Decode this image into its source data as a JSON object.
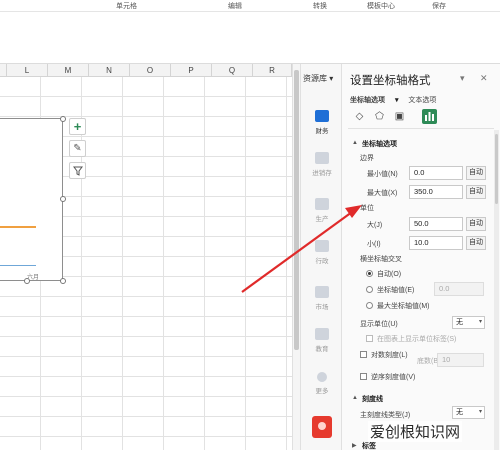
{
  "ribbon": {
    "groups": [
      "单元格",
      "编辑",
      "转换",
      "模板中心",
      "保存"
    ]
  },
  "sheet": {
    "columns": [
      "L",
      "M",
      "N",
      "O",
      "P",
      "Q",
      "R"
    ],
    "chart_axis_label": "六月"
  },
  "resources": {
    "title": "资源库",
    "items": [
      {
        "label": "财务",
        "icon": "wallet-icon"
      },
      {
        "label": "进销存",
        "icon": "store-icon"
      },
      {
        "label": "生产",
        "icon": "factory-icon"
      },
      {
        "label": "行政",
        "icon": "briefcase-icon"
      },
      {
        "label": "市场",
        "icon": "megaphone-icon"
      },
      {
        "label": "教育",
        "icon": "book-icon"
      },
      {
        "label": "更多",
        "icon": "more-icon"
      }
    ]
  },
  "panel": {
    "title": "设置坐标轴格式",
    "tabs": [
      "坐标轴选项",
      "文本选项"
    ],
    "section_axis_options": "坐标轴选项",
    "bounds_label": "边界",
    "min_label": "最小值(N)",
    "min_value": "0.0",
    "max_label": "最大值(X)",
    "max_value": "350.0",
    "auto_label": "自动",
    "units_label": "单位",
    "major_label": "大(J)",
    "major_value": "50.0",
    "minor_label": "小(I)",
    "minor_value": "10.0",
    "cross_label": "横坐标轴交叉",
    "cross_auto": "自动(O)",
    "cross_value_label": "坐标轴值(E)",
    "cross_value": "0.0",
    "cross_max": "最大坐标轴值(M)",
    "display_units_label": "显示单位(U)",
    "display_units_value": "无",
    "show_units_label": "在图表上显示单位标签(S)",
    "log_scale_label": "对数刻度(L)",
    "log_base_label": "底数(B)",
    "log_base_value": "10",
    "reverse_label": "逆序刻度值(V)",
    "section_tick": "刻度线",
    "major_tick_label": "主刻度线类型(J)",
    "major_tick_value": "无",
    "section_labels": "标签"
  },
  "watermark": "爱创根知识网",
  "colors": {
    "accent": "#2e8b57",
    "arrow": "#e02a2a",
    "series1": "#f0a040",
    "series2": "#6fa7d8"
  }
}
